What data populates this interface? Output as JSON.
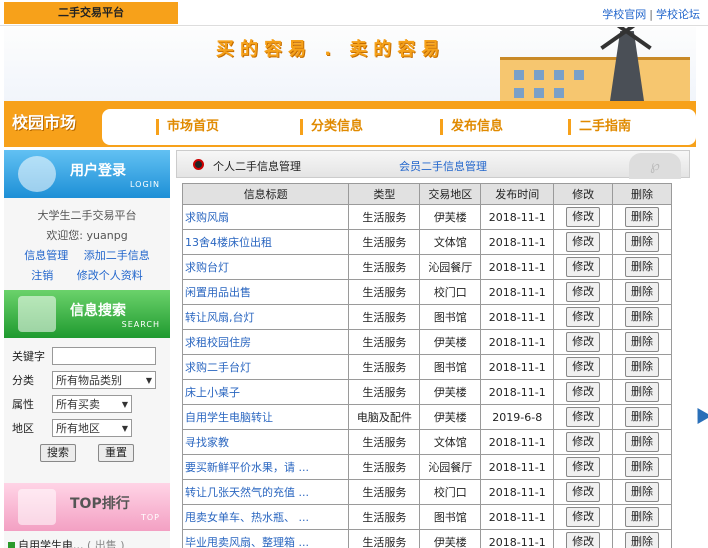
{
  "top": {
    "brand": "二手交易平台",
    "links": [
      "学校官网",
      "学校论坛"
    ]
  },
  "banner": {
    "slogan": "买的容易 . 卖的容易"
  },
  "nav": {
    "logo": "校园市场",
    "items": [
      "市场首页",
      "分类信息",
      "发布信息",
      "二手指南"
    ]
  },
  "user_panel": {
    "title": "用户登录",
    "subtitle": "LOGIN",
    "site_name": "大学生二手交易平台",
    "welcome": "欢迎您: yuanpg",
    "links": [
      "信息管理",
      "添加二手信息",
      "注销",
      "修改个人资料"
    ]
  },
  "search_panel": {
    "title": "信息搜索",
    "subtitle": "SEARCH",
    "keyword_label": "关键字",
    "keyword_value": "",
    "category_label": "分类",
    "category_value": "所有物品类别",
    "attr_label": "属性",
    "attr_value": "所有买卖",
    "area_label": "地区",
    "area_value": "所有地区",
    "search_button": "搜索",
    "reset_button": "重置"
  },
  "top_panel": {
    "title": "TOP排行",
    "subtitle": "TOP",
    "first_item": "自用学生电...",
    "first_tag": "( 出售 )"
  },
  "main": {
    "title": "个人二手信息管理",
    "link": "会员二手信息管理",
    "columns": [
      "信息标题",
      "类型",
      "交易地区",
      "发布时间",
      "修改",
      "删除"
    ],
    "edit_label": "修改",
    "delete_label": "删除",
    "rows": [
      {
        "title": "求购风扇",
        "type": "生活服务",
        "area": "伊芙楼",
        "date": "2018-11-1"
      },
      {
        "title": "13舍4楼床位出租",
        "type": "生活服务",
        "area": "文体馆",
        "date": "2018-11-1"
      },
      {
        "title": "求购台灯",
        "type": "生活服务",
        "area": "沁园餐厅",
        "date": "2018-11-1"
      },
      {
        "title": "闲置用品出售",
        "type": "生活服务",
        "area": "校门口",
        "date": "2018-11-1"
      },
      {
        "title": "转让风扇,台灯",
        "type": "生活服务",
        "area": "图书馆",
        "date": "2018-11-1"
      },
      {
        "title": "求租校园住房",
        "type": "生活服务",
        "area": "伊芙楼",
        "date": "2018-11-1"
      },
      {
        "title": "求购二手台灯",
        "type": "生活服务",
        "area": "图书馆",
        "date": "2018-11-1"
      },
      {
        "title": "床上小桌子",
        "type": "生活服务",
        "area": "伊芙楼",
        "date": "2018-11-1"
      },
      {
        "title": "自用学生电脑转让",
        "type": "电脑及配件",
        "area": "伊芙楼",
        "date": "2019-6-8"
      },
      {
        "title": "寻找家教",
        "type": "生活服务",
        "area": "文体馆",
        "date": "2018-11-1"
      },
      {
        "title": "要买新鲜平价水果，请 ...",
        "type": "生活服务",
        "area": "沁园餐厅",
        "date": "2018-11-1"
      },
      {
        "title": "转让几张天然气的充值 ...",
        "type": "生活服务",
        "area": "校门口",
        "date": "2018-11-1"
      },
      {
        "title": "甩卖女单车、热水瓶、 ...",
        "type": "生活服务",
        "area": "图书馆",
        "date": "2018-11-1"
      },
      {
        "title": "毕业甩卖风扇、整理箱 ...",
        "type": "生活服务",
        "area": "伊芙楼",
        "date": "2018-11-1"
      }
    ]
  }
}
